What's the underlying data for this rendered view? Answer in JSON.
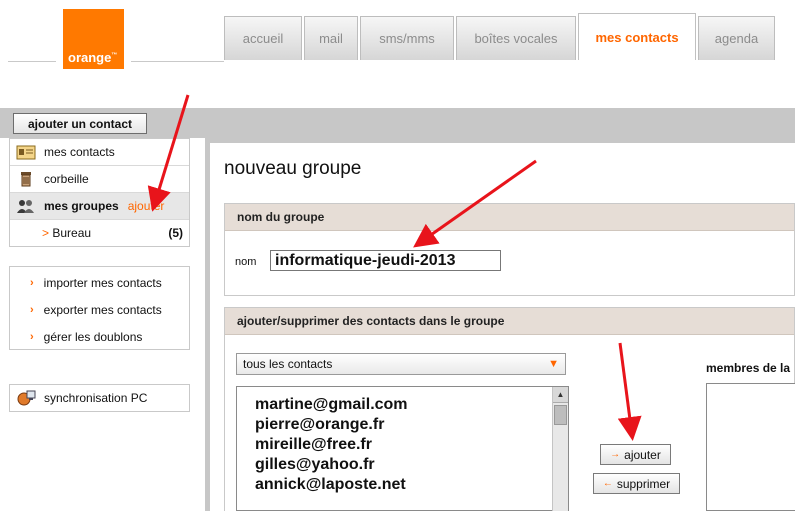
{
  "brand": {
    "logo_text": "orange",
    "trademark": "™",
    "color": "#ff7900"
  },
  "tabs": [
    {
      "label": "accueil",
      "active": false,
      "width": 78
    },
    {
      "label": "mail",
      "active": false,
      "width": 54
    },
    {
      "label": "sms/mms",
      "active": false,
      "width": 94
    },
    {
      "label": "boîtes vocales",
      "active": false,
      "width": 120
    },
    {
      "label": "mes contacts",
      "active": true,
      "width": 118
    },
    {
      "label": "agenda",
      "active": false,
      "width": 77
    }
  ],
  "toolbar": {
    "add_contact_label": "ajouter un contact"
  },
  "sidebar": {
    "my_contacts": "mes contacts",
    "trash": "corbeille",
    "my_groups": "mes groupes",
    "my_groups_add": "ajouter",
    "group_item": {
      "name": "Bureau",
      "count": "(5)"
    },
    "links": [
      "importer mes contacts",
      "exporter mes contacts",
      "gérer les doublons"
    ],
    "sync": "synchronisation PC"
  },
  "main": {
    "title": "nouveau groupe",
    "name_section": {
      "header": "nom du groupe",
      "label": "nom",
      "value": "informatique-jeudi-2013"
    },
    "members_section": {
      "header": "ajouter/supprimer des contacts dans le groupe",
      "filter_selected": "tous les contacts",
      "contacts": [
        "martine@gmail.com",
        "pierre@orange.fr",
        "mireille@free.fr",
        "gilles@yahoo.fr",
        "annick@laposte.net"
      ],
      "add_button": "ajouter",
      "remove_button": "supprimer",
      "members_label": "membres de la"
    }
  },
  "colors": {
    "accent": "#ff6600",
    "annotation_arrow": "#e8141b"
  }
}
